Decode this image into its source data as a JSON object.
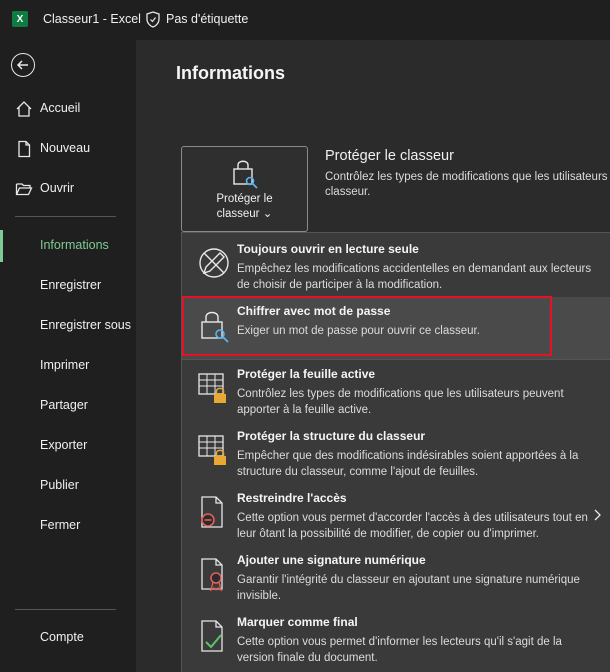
{
  "titlebar": {
    "title": "Classeur1  -  Excel",
    "label": "Pas d'étiquette",
    "app_icon": "excel-icon",
    "label_icon": "shield-icon"
  },
  "sidebar": {
    "items": [
      {
        "label": "Accueil",
        "icon": "home-icon"
      },
      {
        "label": "Nouveau",
        "icon": "new-document-icon"
      },
      {
        "label": "Ouvrir",
        "icon": "folder-open-icon"
      },
      {
        "label": "Informations",
        "active": true
      },
      {
        "label": "Enregistrer"
      },
      {
        "label": "Enregistrer sous"
      },
      {
        "label": "Imprimer"
      },
      {
        "label": "Partager"
      },
      {
        "label": "Exporter"
      },
      {
        "label": "Publier"
      },
      {
        "label": "Fermer"
      },
      {
        "label": "Compte"
      }
    ],
    "accent": "#7ecb95"
  },
  "main": {
    "title": "Informations",
    "protect_button": {
      "line1": "Protéger le",
      "line2": "classeur ⌄"
    },
    "section_title": "Protéger le classeur",
    "section_desc": "Contrôlez les types de modifications que les utilisateurs classeur."
  },
  "dropdown": {
    "items": [
      {
        "title": "Toujours ouvrir en lecture seule",
        "desc": "Empêchez les modifications accidentelles en demandant aux lecteurs de choisir de participer à la modification.",
        "icon": "pencil-no-icon"
      },
      {
        "title": "Chiffrer avec mot de passe",
        "desc": "Exiger un mot de passe pour ouvrir ce classeur.",
        "icon": "lock-key-icon",
        "highlighted": true
      },
      {
        "title": "Protéger la feuille active",
        "desc": "Contrôlez les types de modifications que les utilisateurs peuvent apporter à la feuille active.",
        "icon": "sheet-lock-icon"
      },
      {
        "title": "Protéger la structure du classeur",
        "desc": "Empêcher que des modifications indésirables soient apportées à la structure du classeur, comme l'ajout de feuilles.",
        "icon": "workbook-lock-icon"
      },
      {
        "title": "Restreindre l'accès",
        "desc": "Cette option vous permet d'accorder l'accès à des utilisateurs tout en leur ôtant la possibilité de modifier, de copier ou d'imprimer.",
        "icon": "restrict-access-icon"
      },
      {
        "title": "Ajouter une signature numérique",
        "desc": "Garantir l'intégrité du classeur en ajoutant une signature numérique invisible.",
        "icon": "signature-ribbon-icon"
      },
      {
        "title": "Marquer comme final",
        "desc": "Cette option vous permet d'informer les lecteurs qu'il s'agit de la version finale du document.",
        "icon": "final-check-icon"
      }
    ],
    "highlight_color": "#e81123"
  }
}
